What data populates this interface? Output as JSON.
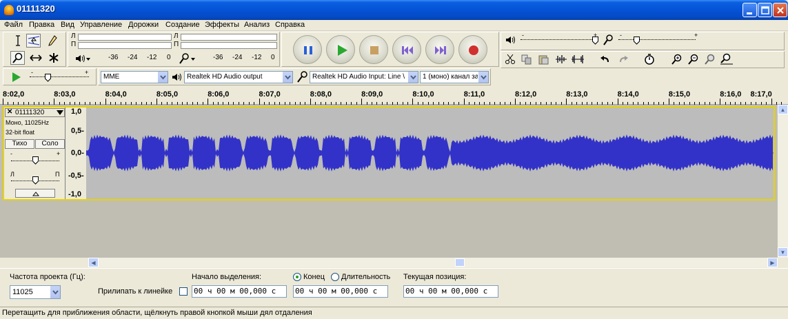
{
  "window": {
    "title": "01111320"
  },
  "menu": [
    "Файл",
    "Правка",
    "Вид",
    "Управление",
    "Дорожки",
    "Создание",
    "Эффекты",
    "Анализ",
    "Справка"
  ],
  "meters": {
    "left_channel": "Л",
    "right_channel": "П",
    "scale": [
      "-36",
      "-24",
      "-12",
      "0"
    ]
  },
  "device": {
    "host": "MME",
    "output": "Realtek HD Audio output",
    "input": "Realtek HD Audio Input: Line \\",
    "channels": "1 (моно) канал за"
  },
  "ruler": {
    "labels": [
      "8:02,0",
      "8:03,0",
      "8:04,0",
      "8:05,0",
      "8:06,0",
      "8:07,0",
      "8:08,0",
      "8:09,0",
      "8:10,0",
      "8:11,0",
      "8:12,0",
      "8:13,0",
      "8:14,0",
      "8:15,0",
      "8:16,0",
      "8:17,0"
    ]
  },
  "track": {
    "name": "01111320",
    "info1": "Моно, 11025Hz",
    "info2": "32-bit float",
    "mute": "Тихо",
    "solo": "Соло",
    "pan_left": "Л",
    "pan_right": "П",
    "gain_minus": "-",
    "gain_plus": "+"
  },
  "vruler": [
    "1,0",
    "0,5-",
    "0,0-",
    "-0,5-",
    "-1,0"
  ],
  "selection": {
    "rate_label": "Частота проекта (Гц):",
    "rate_value": "11025",
    "snap_label": "Прилипать к линейке",
    "start_label": "Начало выделения:",
    "end_label": "Конец",
    "length_label": "Длительность",
    "position_label": "Текущая позиция:",
    "start_time": "00 ч 00 м 00,000 с",
    "end_time": "00 ч 00 м 00,000 с",
    "position_time": "00 ч 00 м 00,000 с"
  },
  "status": "Перетащить для приближения области, щёлкнуть правой кнопкой мыши дял отдаления",
  "colors": {
    "waveform": "#3232c8",
    "track_bg": "#bcbcbc",
    "titlebar": "#0553d6"
  }
}
